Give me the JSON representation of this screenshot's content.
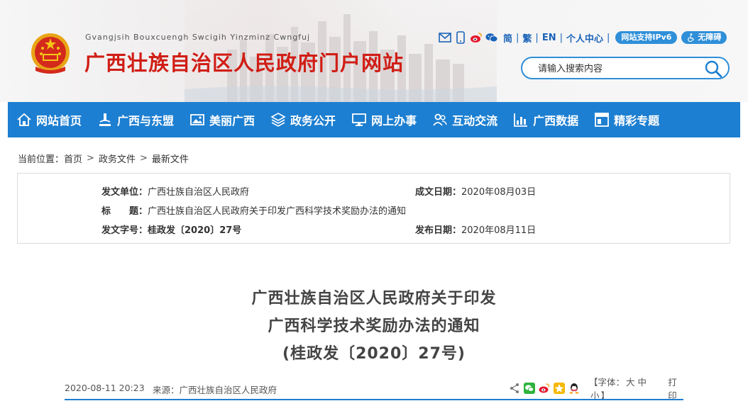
{
  "header": {
    "pinyin": "Gvangjsih Bouxcuengh Swcigih Yinzminz Cwngfuj",
    "title": "广西壮族自治区人民政府门户网站",
    "icons": [
      "mail-icon",
      "mobile-icon",
      "weibo-icon",
      "wechat-icon"
    ],
    "links": [
      "简",
      "繁",
      "EN",
      "个人中心"
    ],
    "ipv6_label": "网站支持IPv6",
    "accessible_label": "无障碍",
    "search_placeholder": "请输入搜索内容"
  },
  "nav": {
    "items": [
      {
        "label": "网站首页",
        "icon": "home-icon"
      },
      {
        "label": "广西与东盟",
        "icon": "microscope-icon"
      },
      {
        "label": "美丽广西",
        "icon": "picture-icon"
      },
      {
        "label": "政务公开",
        "icon": "layers-icon"
      },
      {
        "label": "网上办事",
        "icon": "monitor-icon"
      },
      {
        "label": "互动交流",
        "icon": "users-icon"
      },
      {
        "label": "广西数据",
        "icon": "bar-chart-icon"
      },
      {
        "label": "精彩专题",
        "icon": "panel-icon"
      }
    ]
  },
  "breadcrumb": {
    "prefix": "当前位置：",
    "items": [
      "首页",
      "政务文件",
      "最新文件"
    ]
  },
  "meta": {
    "issuer_label": "发文单位：",
    "issuer": "广西壮族自治区人民政府",
    "created_label": "成文日期：",
    "created": "2020年08月03日",
    "title_label": "标　　题：",
    "title": "广西壮族自治区人民政府关于印发广西科学技术奖励办法的通知",
    "docno_label": "发文字号：",
    "docno": "桂政发〔2020〕27号",
    "published_label": "发布日期：",
    "published": "2020年08月11日"
  },
  "article": {
    "title_lines": [
      "广西壮族自治区人民政府关于印发",
      "广西科学技术奖励办法的通知",
      "(桂政发〔2020〕27号)"
    ]
  },
  "infobar": {
    "datetime": "2020-08-11 20:23",
    "source_label": "来源：广西壮族自治区人民政府",
    "share_icons": [
      "share-icon",
      "wechat-icon",
      "weibo-icon",
      "qzone-icon",
      "qq-icon"
    ],
    "font_label": "【字体：",
    "font_sizes": [
      "大",
      "中",
      "小"
    ],
    "font_close": "】",
    "print": "打印"
  },
  "colors": {
    "brand_red": "#d01e16",
    "nav_blue": "#1d7fd1",
    "link_blue": "#1a63b8"
  }
}
